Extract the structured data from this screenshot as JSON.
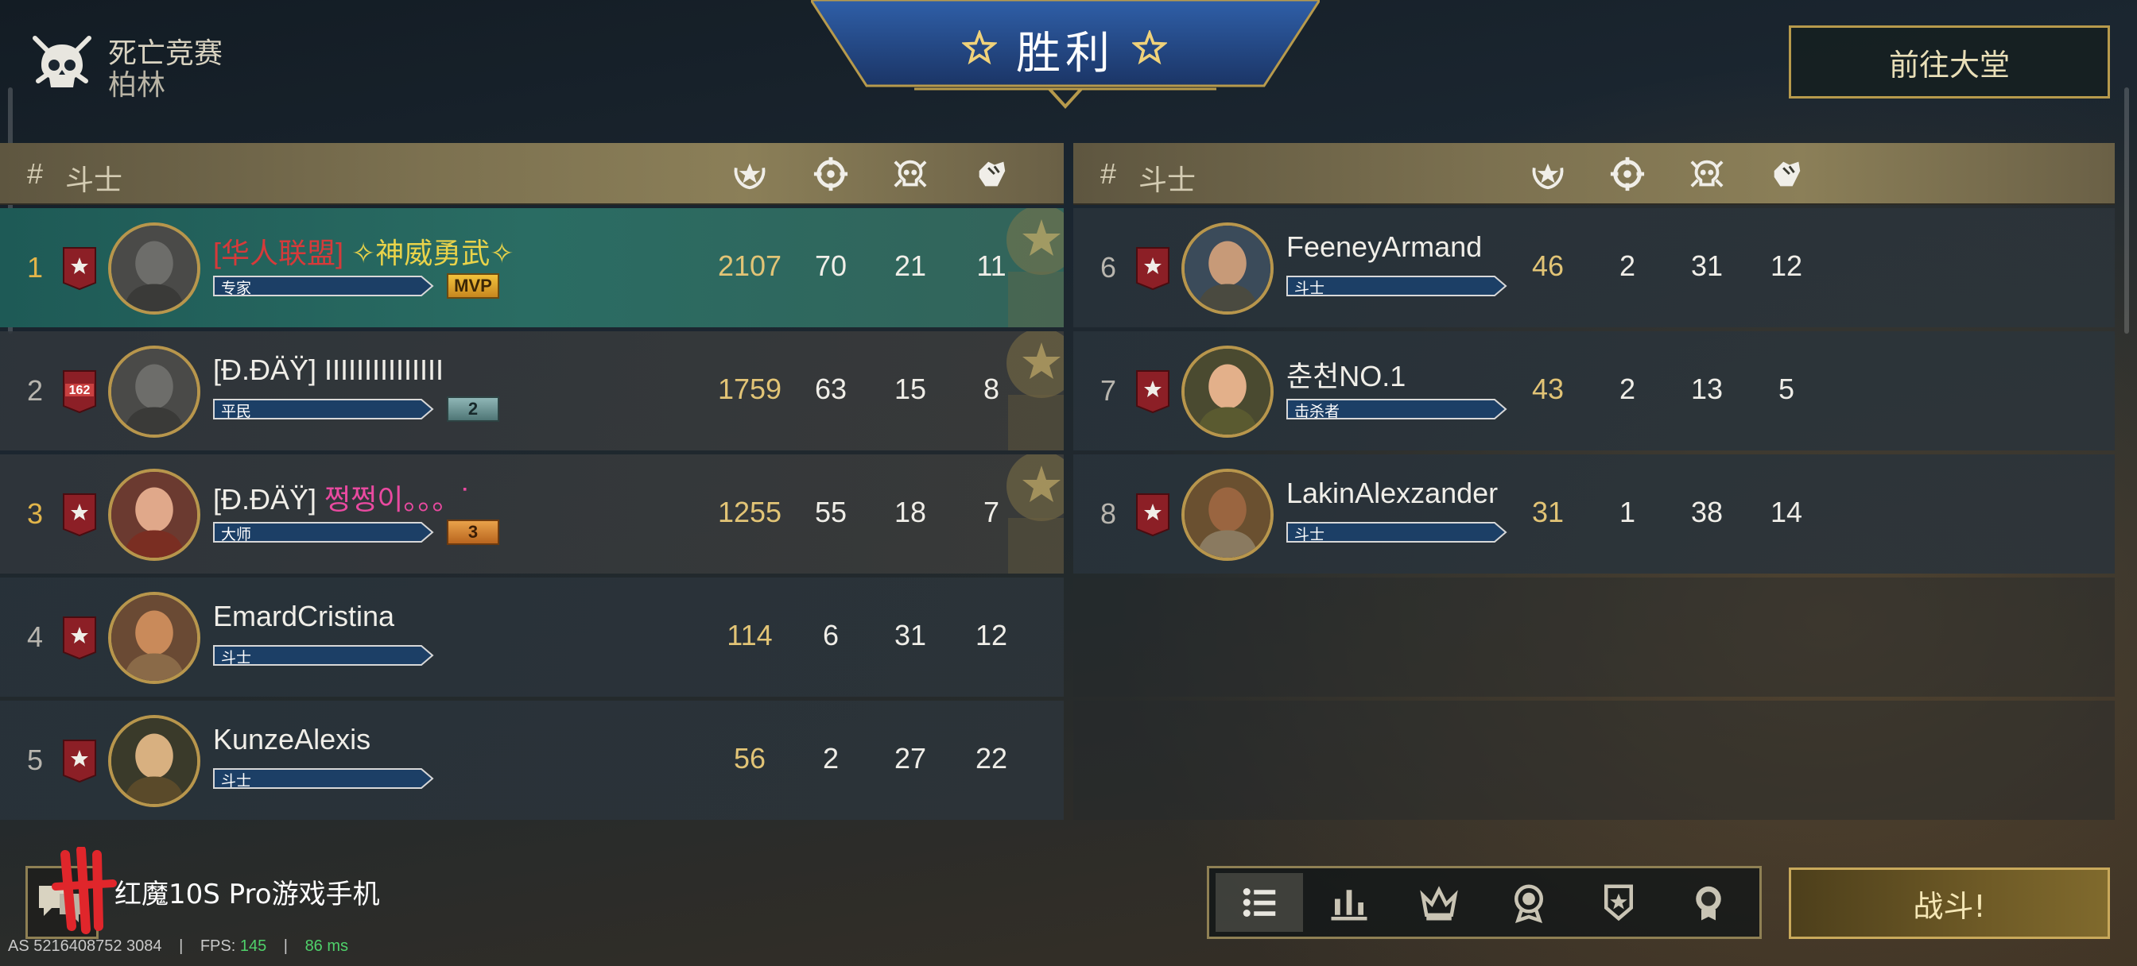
{
  "mode": {
    "title": "死亡竞赛",
    "map": "柏林"
  },
  "banner": {
    "title": "胜利"
  },
  "lobby_button": "前往大堂",
  "fight_button": "战斗!",
  "table_header": {
    "hash": "#",
    "label": "斗士"
  },
  "columns": [
    {
      "icon": "score-wreath-icon"
    },
    {
      "icon": "crosshair-kills-icon"
    },
    {
      "icon": "skull-deaths-icon"
    },
    {
      "icon": "fist-assists-icon"
    }
  ],
  "left_players": [
    {
      "rank": "1",
      "badge": "",
      "tag": "[华人联盟]",
      "name": "✧神威勇武✧",
      "name_style": "gold",
      "level": "专家",
      "chip": "MVP",
      "score": "2107",
      "kills": "70",
      "deaths": "21",
      "assists": "11",
      "highlight": "win",
      "medal": true
    },
    {
      "rank": "2",
      "badge": "162",
      "tag": "",
      "name": "[Ð.ĐÄŸ] IIIIIIIIIIIIIII",
      "name_style": "plain",
      "level": "平民",
      "chip": "2",
      "score": "1759",
      "kills": "63",
      "deaths": "15",
      "assists": "8",
      "highlight": "dim",
      "medal": true
    },
    {
      "rank": "3",
      "badge": "",
      "tag": "",
      "name": "[Ð.ĐÄŸ] ",
      "name_extra": "쩡쩡이。。。ᐝ",
      "name_style": "pink",
      "level": "大师",
      "chip": "3",
      "score": "1255",
      "kills": "55",
      "deaths": "18",
      "assists": "7",
      "highlight": "dim",
      "medal": true
    },
    {
      "rank": "4",
      "badge": "",
      "tag": "",
      "name": "EmardCristina",
      "name_style": "plain",
      "level": "斗士",
      "chip": "",
      "score": "114",
      "kills": "6",
      "deaths": "31",
      "assists": "12",
      "highlight": "",
      "medal": false
    },
    {
      "rank": "5",
      "badge": "",
      "tag": "",
      "name": "KunzeAlexis",
      "name_style": "plain",
      "level": "斗士",
      "chip": "",
      "score": "56",
      "kills": "2",
      "deaths": "27",
      "assists": "22",
      "highlight": "",
      "medal": false
    }
  ],
  "right_players": [
    {
      "rank": "6",
      "name": "FeeneyArmand",
      "level": "斗士",
      "score": "46",
      "kills": "2",
      "deaths": "31",
      "assists": "12"
    },
    {
      "rank": "7",
      "name": "춘천NO.1",
      "level": "击杀者",
      "score": "43",
      "kills": "2",
      "deaths": "13",
      "assists": "5"
    },
    {
      "rank": "8",
      "name": "LakinAlexzander",
      "level": "斗士",
      "score": "31",
      "kills": "1",
      "deaths": "38",
      "assists": "14"
    }
  ],
  "bottom_tabs": [
    {
      "icon": "list-icon",
      "active": true
    },
    {
      "icon": "bar-chart-icon",
      "active": false
    },
    {
      "icon": "crown-icon",
      "active": false
    },
    {
      "icon": "medal-icon",
      "active": false
    },
    {
      "icon": "star-badge-icon",
      "active": false
    },
    {
      "icon": "ribbon-medal-icon",
      "active": false
    }
  ],
  "watermark": {
    "text": "红魔10S Pro游戏手机"
  },
  "debug": {
    "as": "AS 5216408752 3084",
    "sep": "|",
    "fps_label": "FPS:",
    "fps": "145",
    "ping": "86 ms"
  },
  "colors": {
    "accent_gold": "#b79a4c",
    "win_row": "#2a6c63",
    "score": "#e2c476",
    "fps": "#4fd16a"
  }
}
